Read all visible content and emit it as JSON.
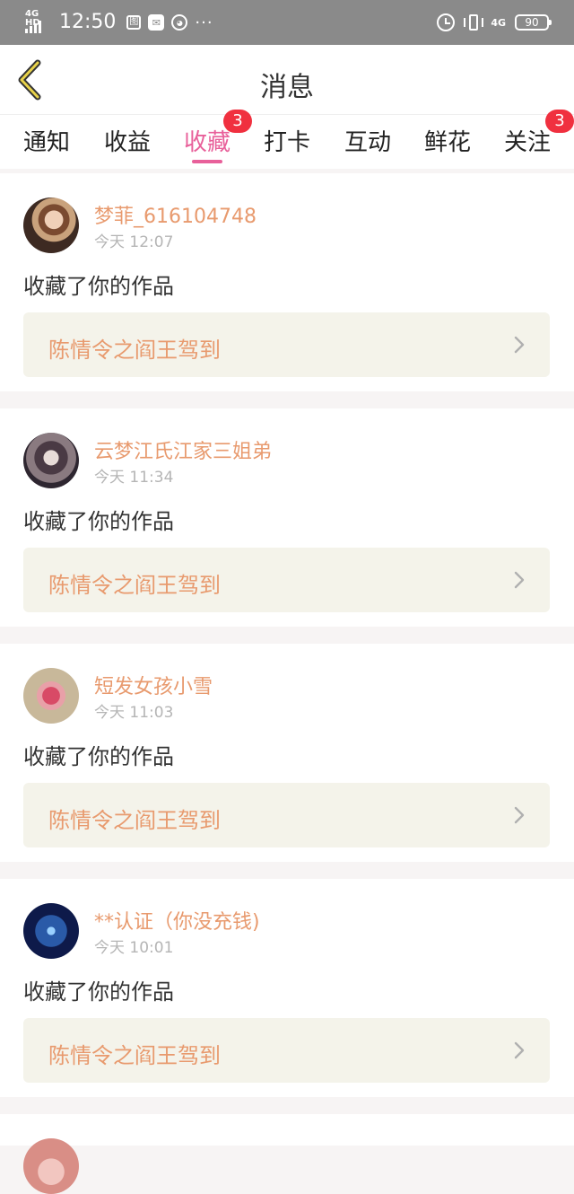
{
  "status_bar": {
    "network": "4G HD",
    "time": "12:50",
    "notif_icons": [
      "image-icon",
      "mail-icon",
      "face-icon"
    ],
    "more": "···",
    "net_type": "4G",
    "battery": "90"
  },
  "header": {
    "back_icon": "chevron-left-icon",
    "title": "消息"
  },
  "tabs": [
    {
      "label": "通知"
    },
    {
      "label": "收益"
    },
    {
      "label": "收藏",
      "badge": "3",
      "active": true
    },
    {
      "label": "打卡"
    },
    {
      "label": "互动"
    },
    {
      "label": "鲜花"
    },
    {
      "label": "关注",
      "badge": "3"
    }
  ],
  "feed": [
    {
      "name": "梦菲_616104748",
      "time": "今天 12:07",
      "action": "收藏了你的作品",
      "work_title": "陈情令之阎王驾到"
    },
    {
      "name": "云梦江氏江家三姐弟",
      "time": "今天 11:34",
      "action": "收藏了你的作品",
      "work_title": "陈情令之阎王驾到"
    },
    {
      "name": "短发女孩小雪",
      "time": "今天 11:03",
      "action": "收藏了你的作品",
      "work_title": "陈情令之阎王驾到"
    },
    {
      "name": "**认证（你没充钱)",
      "time": "今天 10:01",
      "action": "收藏了你的作品",
      "work_title": "陈情令之阎王驾到"
    }
  ],
  "colors": {
    "accent_pink": "#e8609a",
    "badge_red": "#f0303f",
    "name_orange": "#e89a6e",
    "card_bg": "#f4f3ea",
    "status_bar_bg": "#8a8a8a"
  }
}
